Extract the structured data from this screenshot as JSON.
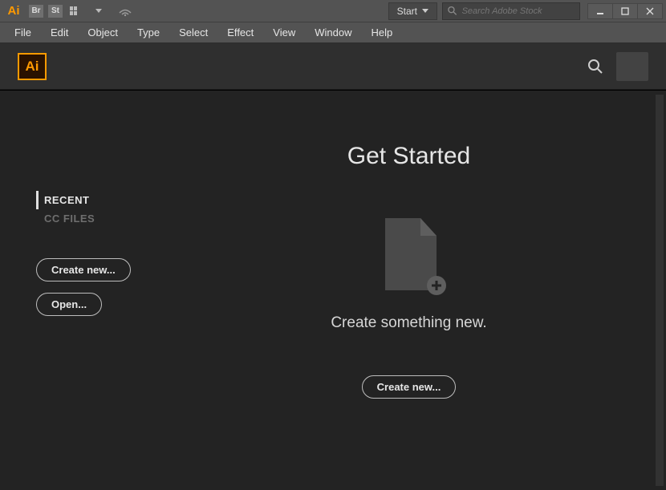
{
  "titlebar": {
    "app_abbrev": "Ai",
    "br_label": "Br",
    "st_label": "St",
    "start_label": "Start",
    "search_placeholder": "Search Adobe Stock"
  },
  "menubar": [
    "File",
    "Edit",
    "Object",
    "Type",
    "Select",
    "Effect",
    "View",
    "Window",
    "Help"
  ],
  "header": {
    "app_abbrev": "Ai"
  },
  "sidebar": {
    "tabs": [
      {
        "label": "RECENT",
        "active": true
      },
      {
        "label": "CC FILES",
        "active": false
      }
    ],
    "create_new_label": "Create new...",
    "open_label": "Open..."
  },
  "main": {
    "title": "Get Started",
    "subtitle": "Create something new.",
    "create_new_label": "Create new..."
  },
  "colors": {
    "accent": "#ff9a00",
    "bg_dark": "#232323",
    "bg_mid": "#535353"
  }
}
